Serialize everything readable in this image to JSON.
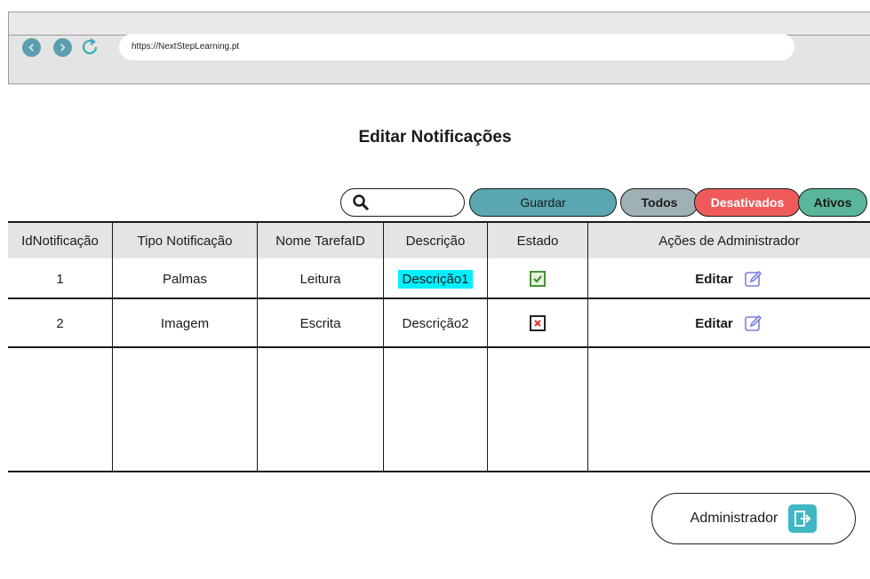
{
  "browser": {
    "url": "https://NextStepLearning.pt"
  },
  "page": {
    "title": "Editar Notificações"
  },
  "toolbar": {
    "search_placeholder": "",
    "guardar_label": "Guardar",
    "todos_label": "Todos",
    "desativados_label": "Desativados",
    "ativos_label": "Ativos"
  },
  "table": {
    "headers": [
      "IdNotificação",
      "Tipo Notificação",
      "Nome TarefaID",
      "Descrição",
      "Estado",
      "Ações de Administrador"
    ],
    "rows": [
      {
        "id": "1",
        "tipo": "Palmas",
        "nome": "Leitura",
        "descricao": "Descrição1",
        "estado": "active",
        "acao": "Editar"
      },
      {
        "id": "2",
        "tipo": "Imagem",
        "nome": "Escrita",
        "descricao": "Descrição2",
        "estado": "inactive",
        "acao": "Editar"
      }
    ]
  },
  "footer": {
    "admin_label": "Administrador"
  },
  "colors": {
    "guardar": "#5aa7b1",
    "todos": "#9fb1b5",
    "desativados": "#ef5b5b",
    "ativos": "#5ab69a",
    "highlight": "#00f0ff"
  },
  "icons": {
    "back": "back-arrow-icon",
    "forward": "forward-arrow-icon",
    "reload": "reload-icon",
    "search": "magnifier-icon",
    "check": "checkmark-icon",
    "cross": "cross-icon",
    "edit": "pencil-edit-icon",
    "exit": "exit-door-icon"
  }
}
